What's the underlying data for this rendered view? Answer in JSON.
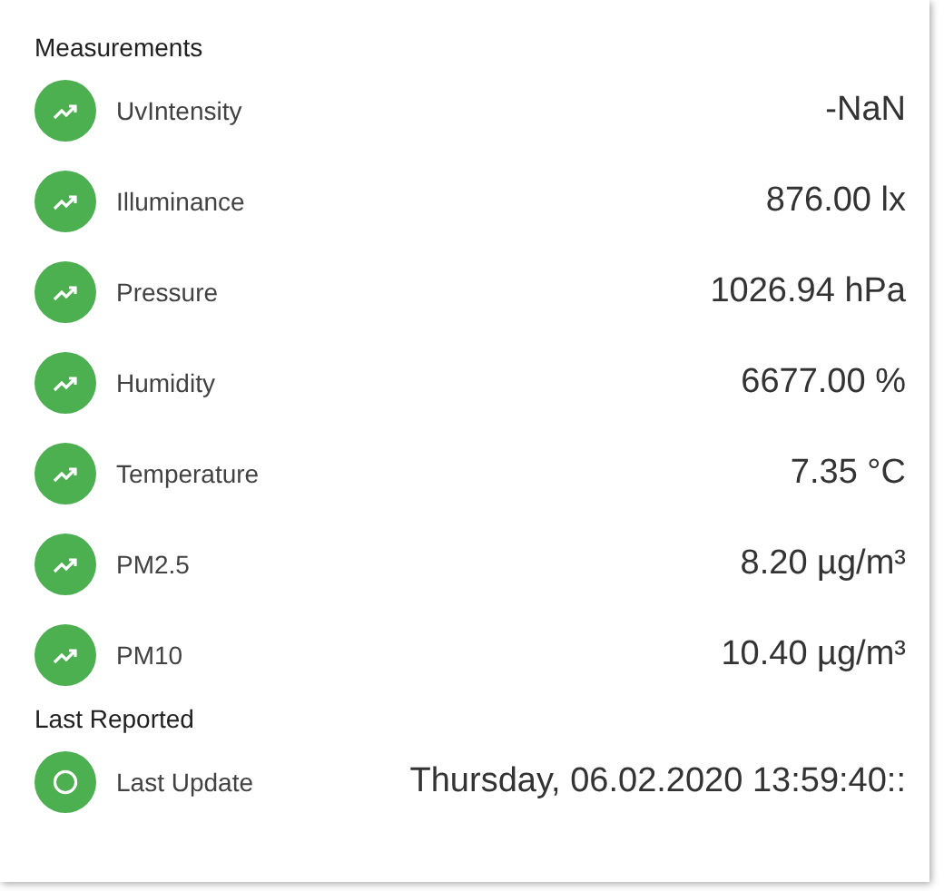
{
  "sections": [
    {
      "title": "Measurements",
      "rows": [
        {
          "kind": "trend",
          "label": "UvIntensity",
          "value": "-NaN"
        },
        {
          "kind": "trend",
          "label": "Illuminance",
          "value": "876.00 lx"
        },
        {
          "kind": "trend",
          "label": "Pressure",
          "value": "1026.94 hPa"
        },
        {
          "kind": "trend",
          "label": "Humidity",
          "value": "6677.00 %"
        },
        {
          "kind": "trend",
          "label": "Temperature",
          "value": "7.35 °C"
        },
        {
          "kind": "trend",
          "label": "PM2.5",
          "value": "8.20 µg/m³"
        },
        {
          "kind": "trend",
          "label": "PM10",
          "value": "10.40 µg/m³"
        }
      ]
    },
    {
      "title": "Last Reported",
      "rows": [
        {
          "kind": "clock",
          "label": "Last Update",
          "value": "Thursday, 06.02.2020 13:59:40::"
        }
      ]
    }
  ]
}
